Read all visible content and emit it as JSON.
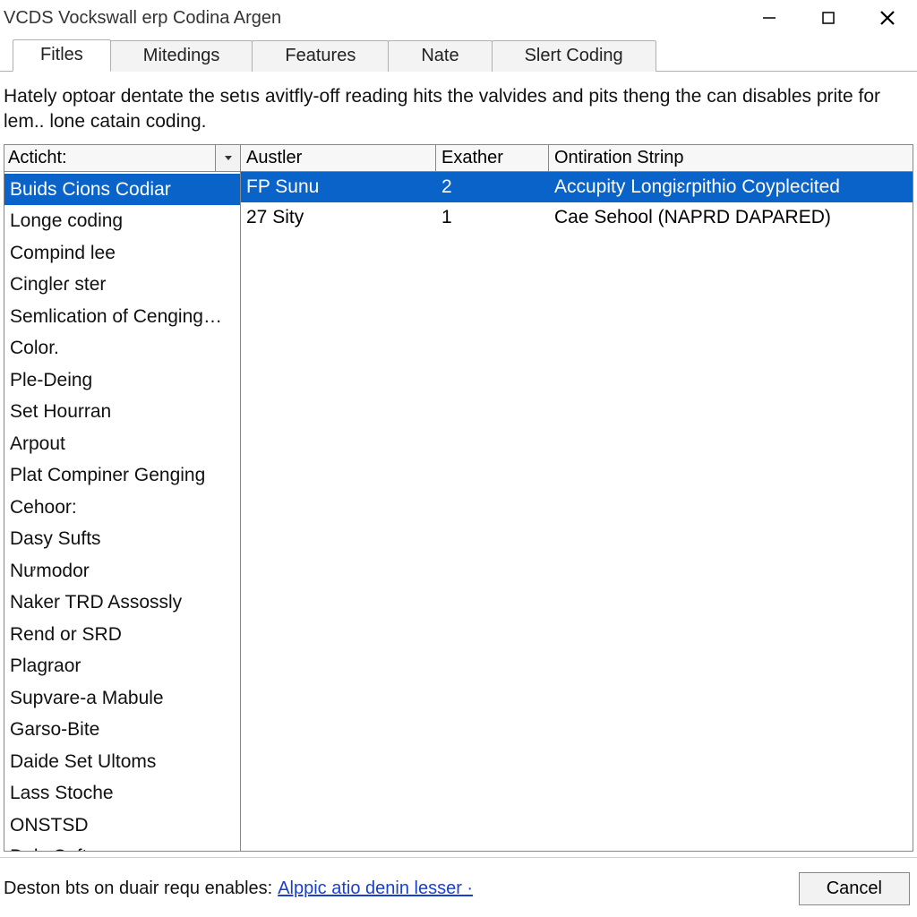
{
  "window": {
    "title": "VCDS Vockswall erp Codina Argen"
  },
  "tabs": [
    {
      "label": "Fitles",
      "active": true
    },
    {
      "label": "Mitedings",
      "active": false
    },
    {
      "label": "Features",
      "active": false
    },
    {
      "label": "Nate",
      "active": false
    },
    {
      "label": "Slert Coding",
      "active": false
    }
  ],
  "description": "Hately optoar dentate the setıs avitfly-off reading hits the valvides and pits theng the can disables prite for lem.. lone catain coding.",
  "left": {
    "header": "Acticht:",
    "items": [
      {
        "label": "Buids Cions Codiar",
        "selected": true
      },
      {
        "label": "Longe coding",
        "selected": false
      },
      {
        "label": "Compind lee",
        "selected": false
      },
      {
        "label": "Cingleɾ ster",
        "selected": false
      },
      {
        "label": "Semlication of Cenging…",
        "selected": false
      },
      {
        "label": "Color.",
        "selected": false
      },
      {
        "label": "Ple-Deing",
        "selected": false
      },
      {
        "label": "Set Hourran",
        "selected": false
      },
      {
        "label": "Arpout",
        "selected": false
      },
      {
        "label": "Plat Compiner Genging",
        "selected": false
      },
      {
        "label": "Cehoor:",
        "selected": false
      },
      {
        "label": "Dasy Sufts",
        "selected": false
      },
      {
        "label": "Nưmodor",
        "selected": false
      },
      {
        "label": "Naker TRD Assossly",
        "selected": false
      },
      {
        "label": "Rend or SRD",
        "selected": false
      },
      {
        "label": "Plagraor",
        "selected": false
      },
      {
        "label": "Supvare-a Mabule",
        "selected": false
      },
      {
        "label": "Garso-Bite",
        "selected": false
      },
      {
        "label": "Daide Set Ultoms",
        "selected": false
      },
      {
        "label": "Lass Stoche",
        "selected": false
      },
      {
        "label": "ONSTSD",
        "selected": false
      },
      {
        "label": "Dely Cafts",
        "selected": false
      }
    ]
  },
  "right": {
    "columns": [
      "Austler",
      "Exather",
      "Ontiration Strinp"
    ],
    "rows": [
      {
        "c1": "FP Sunu",
        "c2": "2",
        "c3": "Accupity Longiɛɾpithio Coyplecited",
        "selected": true
      },
      {
        "c1": "27 Sity",
        "c2": "1",
        "c3": "Cae Sehool (NAPRD DAPARED)",
        "selected": false
      }
    ]
  },
  "footer": {
    "label": "Deston bts on duair requ enables:",
    "link": "Alppic atio denin lesser ·",
    "cancel": "Cancel"
  }
}
